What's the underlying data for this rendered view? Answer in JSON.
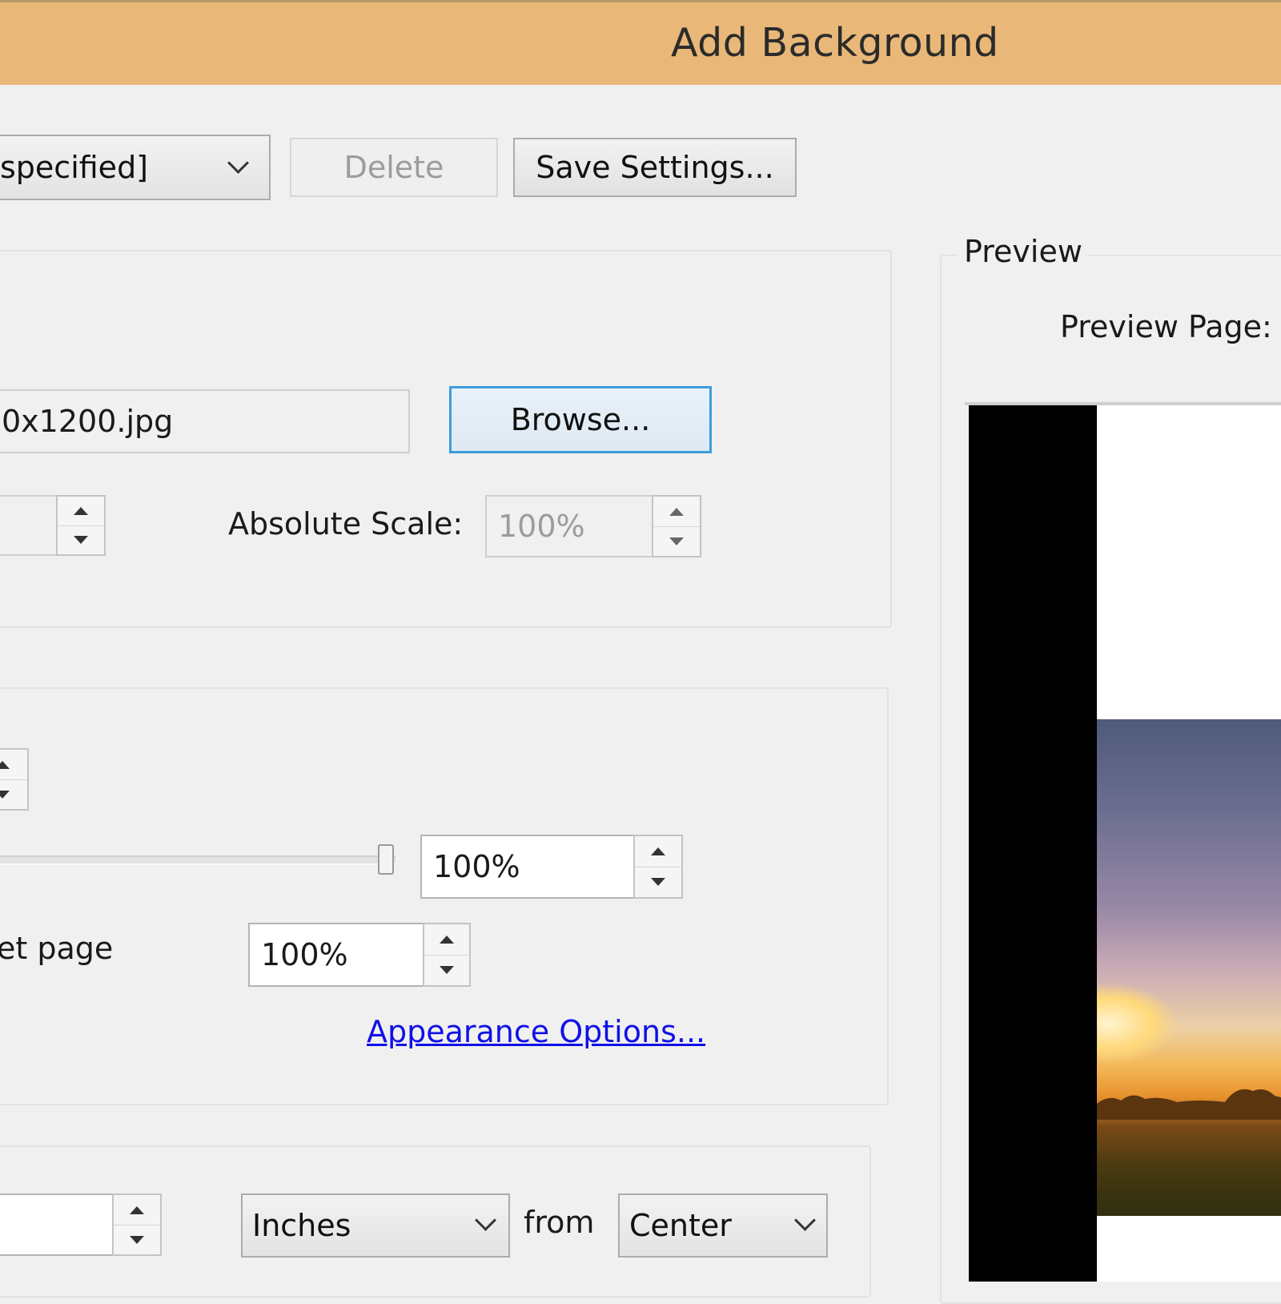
{
  "window": {
    "title": "Add Background"
  },
  "toolbar": {
    "settings_value": "specified]",
    "delete_label": "Delete",
    "save_label": "Save Settings..."
  },
  "source": {
    "file_value": "0x1200.jpg",
    "browse_label": "Browse...",
    "absolute_scale_label": "Absolute Scale:",
    "absolute_scale_value": "100%"
  },
  "appearance": {
    "opacity_value": "100%",
    "opacity_level": 1.0,
    "target_page_label": "et page",
    "target_scale_value": "100%",
    "appearance_options_link": "Appearance Options..."
  },
  "position": {
    "units_value": "Inches",
    "from_label": "from",
    "anchor_value": "Center"
  },
  "preview": {
    "group_label": "Preview",
    "page_label": "Preview Page:"
  }
}
